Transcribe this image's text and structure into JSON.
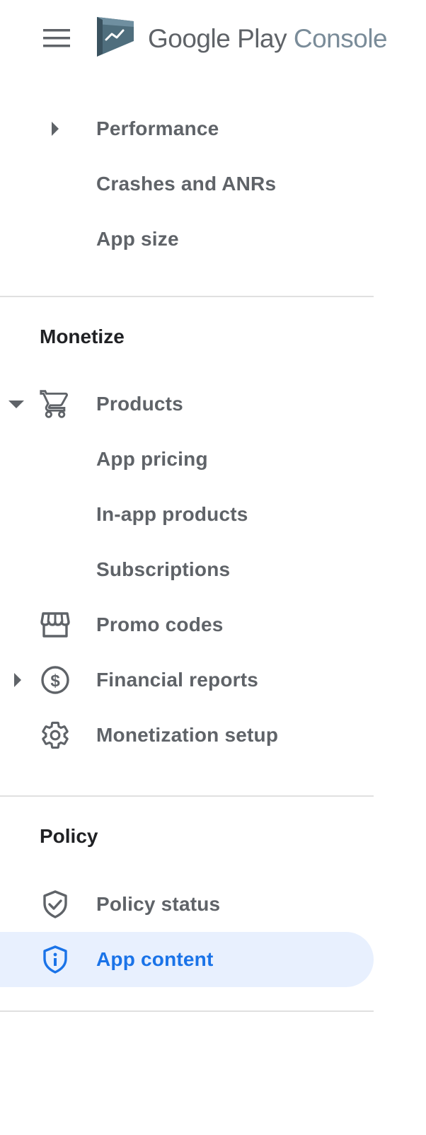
{
  "header": {
    "logo_google": "Google Play",
    "logo_console": "Console",
    "menu_icon": "hamburger-menu-icon",
    "logo_icon": "play-console-logo-icon"
  },
  "nav": {
    "quality_items": [
      {
        "label": "Performance",
        "caret": "collapsed"
      },
      {
        "label": "Crashes and ANRs"
      },
      {
        "label": "App size"
      }
    ],
    "monetize": {
      "title": "Monetize",
      "items": [
        {
          "label": "Products",
          "icon": "cart-icon",
          "caret": "expanded"
        },
        {
          "label": "App pricing"
        },
        {
          "label": "In-app products"
        },
        {
          "label": "Subscriptions"
        },
        {
          "label": "Promo codes",
          "icon": "storefront-icon"
        },
        {
          "label": "Financial reports",
          "icon": "dollar-circle-icon",
          "caret": "collapsed"
        },
        {
          "label": "Monetization setup",
          "icon": "gear-icon"
        }
      ]
    },
    "policy": {
      "title": "Policy",
      "items": [
        {
          "label": "Policy status",
          "icon": "shield-check-icon"
        },
        {
          "label": "App content",
          "icon": "shield-info-icon",
          "active": true
        }
      ]
    }
  },
  "colors": {
    "text": "#5f6368",
    "heading": "#202124",
    "active_text": "#1a73e8",
    "active_bg": "#e8f0fe",
    "divider": "#e0e0e0",
    "logo_console": "#7a8c99"
  }
}
